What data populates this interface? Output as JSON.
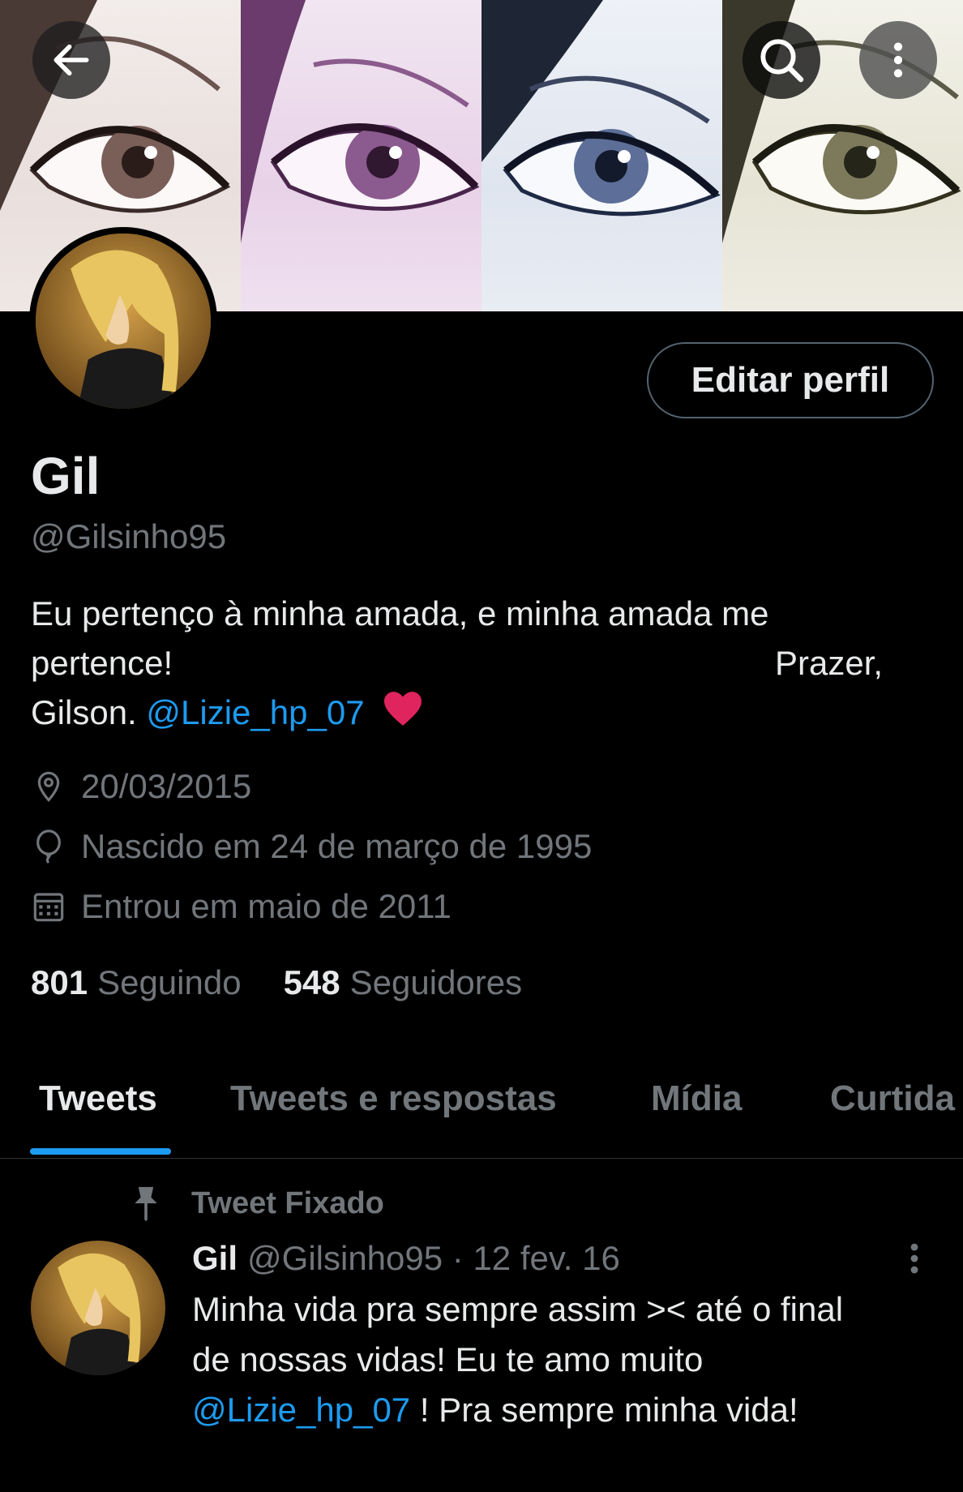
{
  "header": {
    "back_icon": "arrow-left-icon",
    "search_icon": "search-icon",
    "more_icon": "more-vertical-icon"
  },
  "profile": {
    "edit_button": "Editar perfil",
    "name": "Gil",
    "handle": "@Gilsinho95",
    "bio": {
      "line1": "Eu pertenço à minha amada, e minha amada me",
      "line2_left": "pertence!",
      "line2_right": "Prazer,",
      "line3_text": "Gilson.",
      "line3_mention": "@Lizie_hp_07",
      "heart_color": "#f91880"
    },
    "location": "20/03/2015",
    "birthday": "Nascido em 24 de março de 1995",
    "joined": "Entrou em maio de 2011",
    "following_count": "801",
    "following_label": "Seguindo",
    "followers_count": "548",
    "followers_label": "Seguidores"
  },
  "tabs": [
    {
      "label": "Tweets",
      "active": true
    },
    {
      "label": "Tweets e respostas",
      "active": false
    },
    {
      "label": "Mídia",
      "active": false
    },
    {
      "label": "Curtida",
      "active": false
    }
  ],
  "pinned_tweet": {
    "pinned_label": "Tweet Fixado",
    "author_name": "Gil",
    "author_handle": "@Gilsinho95",
    "separator": "·",
    "date": "12 fev. 16",
    "line1": "Minha vida pra sempre assim >< até o final",
    "line2": "de nossas vidas! Eu te amo muito",
    "line3_mention": "@Lizie_hp_07",
    "line3_text": " ! Pra sempre minha vida!"
  },
  "colors": {
    "background": "#000000",
    "text_primary": "#e7e9ea",
    "text_secondary": "#71767b",
    "accent": "#1d9bf0",
    "border": "#2f3336"
  }
}
